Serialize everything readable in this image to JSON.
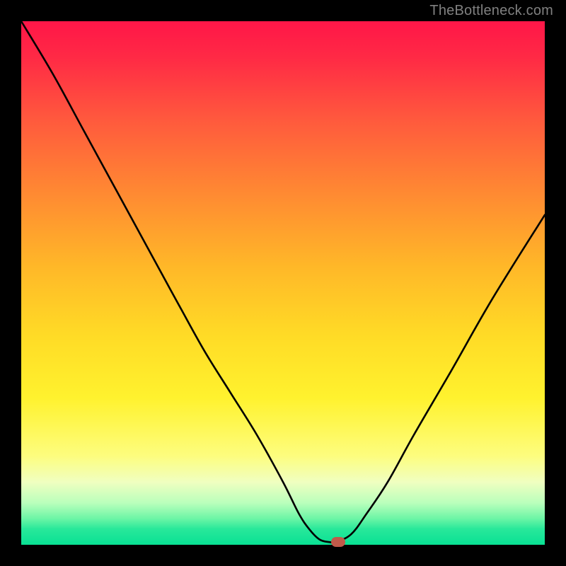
{
  "watermark": "TheBottleneck.com",
  "chart_data": {
    "type": "line",
    "title": "",
    "xlabel": "",
    "ylabel": "",
    "xlim": [
      0,
      100
    ],
    "ylim": [
      0,
      100
    ],
    "grid": false,
    "legend": false,
    "series": [
      {
        "name": "bottleneck-curve",
        "x": [
          0,
          6,
          12,
          18,
          24,
          30,
          35,
          40,
          45,
          50,
          53,
          55,
          57,
          59,
          60,
          63,
          66,
          70,
          75,
          82,
          90,
          100
        ],
        "y": [
          100,
          90,
          79,
          68,
          57,
          46,
          37,
          29,
          21,
          12,
          6,
          3,
          1,
          0.5,
          0.5,
          2,
          6,
          12,
          21,
          33,
          47,
          63
        ]
      }
    ],
    "marker": {
      "x": 60.5,
      "y": 0.5,
      "color": "#c05a4a"
    },
    "gradient_stops": [
      {
        "pct": 0,
        "color": "#ff1648"
      },
      {
        "pct": 7,
        "color": "#ff2a45"
      },
      {
        "pct": 19,
        "color": "#ff5a3d"
      },
      {
        "pct": 33,
        "color": "#ff8a32"
      },
      {
        "pct": 47,
        "color": "#ffb828"
      },
      {
        "pct": 60,
        "color": "#ffdb26"
      },
      {
        "pct": 72,
        "color": "#fff22e"
      },
      {
        "pct": 83,
        "color": "#fdfd7e"
      },
      {
        "pct": 88,
        "color": "#f0ffc0"
      },
      {
        "pct": 92,
        "color": "#baffbc"
      },
      {
        "pct": 95,
        "color": "#6cf5a6"
      },
      {
        "pct": 97,
        "color": "#28e89a"
      },
      {
        "pct": 100,
        "color": "#09e194"
      }
    ]
  }
}
